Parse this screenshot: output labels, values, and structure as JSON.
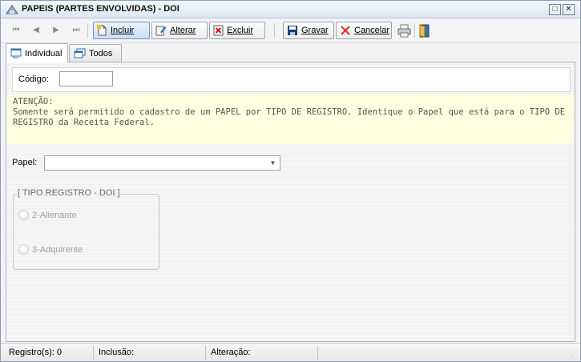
{
  "window": {
    "title": "PAPEIS (PARTES ENVOLVIDAS) - DOI",
    "maximize_symbol": "□",
    "close_symbol": "✕"
  },
  "toolbar": {
    "nav": {
      "first": "⏮",
      "prev": "◀",
      "next": "▶",
      "last": "⏭"
    },
    "incluir_label": "Incluir",
    "alterar_label": "Alterar",
    "excluir_label": "Excluir",
    "gravar_label": "Gravar",
    "cancelar_label": "Cancelar"
  },
  "tabs": [
    {
      "label": "Individual",
      "selected": true
    },
    {
      "label": "Todos",
      "selected": false
    }
  ],
  "form": {
    "codigo_label": "Código:",
    "codigo_value": "",
    "notice_title": "ATENÇÃO:",
    "notice_line1": "Somente será permitido o cadastro de um PAPEL por TIPO DE REGISTRO. Identique o Papel que está para o TIPO DE",
    "notice_line2": "REGISTRO da Receita Federal.",
    "papel_label": "Papel:",
    "papel_value": "",
    "group_title": "[ TIPO REGISTRO - DOI ]",
    "radio_options": [
      "2-Alienante",
      "3-Adquirente"
    ]
  },
  "status": {
    "registros": "Registro(s): 0",
    "inclusao": "Inclusão:",
    "alteracao": "Alteração:"
  },
  "colors": {
    "notice_bg": "#ffffe1",
    "title_gradient_top": "#f4f7fb",
    "active_button": "#c9def5"
  }
}
